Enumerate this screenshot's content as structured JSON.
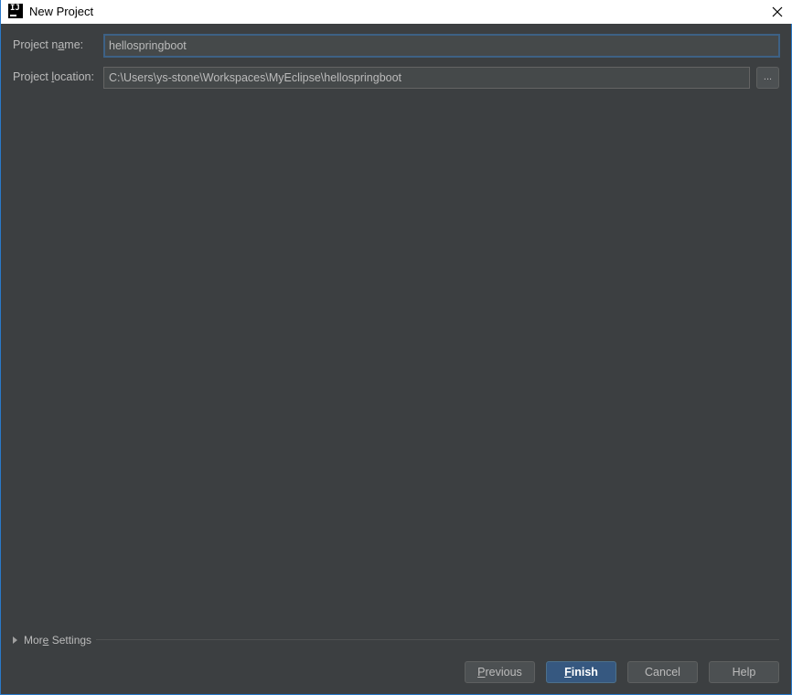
{
  "window": {
    "title": "New Project"
  },
  "form": {
    "project_name": {
      "label_pre": "Project n",
      "label_mnemonic": "a",
      "label_post": "me:",
      "value": "hellospringboot"
    },
    "project_location": {
      "label_pre": "Project ",
      "label_mnemonic": "l",
      "label_post": "ocation:",
      "value": "C:\\Users\\ys-stone\\Workspaces\\MyEclipse\\hellospringboot",
      "browse_label": "..."
    }
  },
  "more_settings": {
    "label_pre": "Mor",
    "label_mnemonic": "e",
    "label_post": " Settings"
  },
  "buttons": {
    "previous": {
      "mnemonic": "P",
      "rest": "revious"
    },
    "finish": {
      "mnemonic": "F",
      "rest": "inish"
    },
    "cancel": "Cancel",
    "help": "Help"
  },
  "icons": {
    "app": "intellij-idea-icon",
    "close": "close-icon",
    "expand": "triangle-right-icon"
  },
  "colors": {
    "background": "#3c3f41",
    "primary_button": "#365880",
    "focus_border": "#3d6185"
  }
}
